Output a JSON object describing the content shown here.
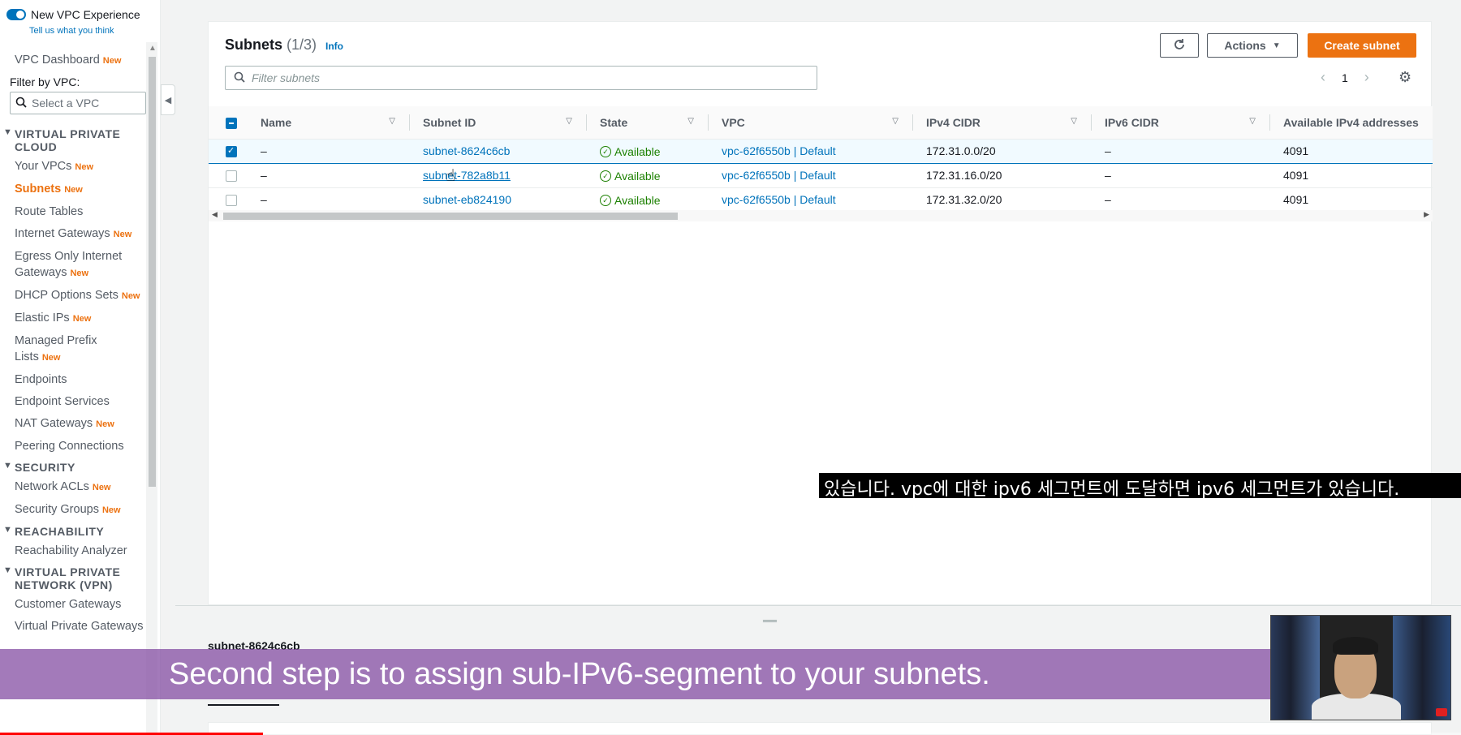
{
  "sidebar": {
    "toggle_label": "New VPC Experience",
    "toggle_sub": "Tell us what you think",
    "dashboard": "VPC Dashboard",
    "new_badge": "New",
    "filter_label": "Filter by VPC:",
    "filter_placeholder": "Select a VPC",
    "section_vpc": "VIRTUAL PRIVATE CLOUD",
    "items_vpc": [
      {
        "label": "Your VPCs",
        "new": true
      },
      {
        "label": "Subnets",
        "new": true
      },
      {
        "label": "Route Tables",
        "new": false
      },
      {
        "label": "Internet Gateways",
        "new": true
      },
      {
        "label": "Egress Only Internet Gateways",
        "new": true
      },
      {
        "label": "DHCP Options Sets",
        "new": true
      },
      {
        "label": "Elastic IPs",
        "new": true
      },
      {
        "label": "Managed Prefix Lists",
        "new": true
      },
      {
        "label": "Endpoints",
        "new": false
      },
      {
        "label": "Endpoint Services",
        "new": false
      },
      {
        "label": "NAT Gateways",
        "new": true
      },
      {
        "label": "Peering Connections",
        "new": false
      }
    ],
    "section_security": "SECURITY",
    "items_security": [
      {
        "label": "Network ACLs",
        "new": true
      },
      {
        "label": "Security Groups",
        "new": true
      }
    ],
    "section_reachability": "REACHABILITY",
    "items_reachability": [
      {
        "label": "Reachability Analyzer"
      }
    ],
    "section_vpn": "VIRTUAL PRIVATE NETWORK (VPN)",
    "items_vpn": [
      {
        "label": "Customer Gateways"
      },
      {
        "label": "Virtual Private Gateways"
      }
    ]
  },
  "main": {
    "title": "Subnets",
    "count": "(1/3)",
    "info": "Info",
    "actions_label": "Actions",
    "create_label": "Create subnet",
    "search_placeholder": "Filter subnets",
    "page_number": "1",
    "columns": [
      "Name",
      "Subnet ID",
      "State",
      "VPC",
      "IPv4 CIDR",
      "IPv6 CIDR",
      "Available IPv4 addresses"
    ],
    "rows": [
      {
        "selected": true,
        "name": "–",
        "subnet_id": "subnet-8624c6cb",
        "state": "Available",
        "vpc": "vpc-62f6550b | Default",
        "ipv4": "172.31.0.0/20",
        "ipv6": "–",
        "available": "4091"
      },
      {
        "selected": false,
        "name": "–",
        "subnet_id": "subnet-782a8b11",
        "state": "Available",
        "vpc": "vpc-62f6550b | Default",
        "ipv4": "172.31.16.0/20",
        "ipv6": "–",
        "available": "4091"
      },
      {
        "selected": false,
        "name": "–",
        "subnet_id": "subnet-eb824190",
        "state": "Available",
        "vpc": "vpc-62f6550b | Default",
        "ipv4": "172.31.32.0/20",
        "ipv6": "–",
        "available": "4091"
      }
    ]
  },
  "detail": {
    "title": "subnet-8624c6cb"
  },
  "captions": {
    "korean": "있습니다. vpc에 대한 ipv6 세그먼트에 도달하면 ipv6 세그먼트가 있습니다.",
    "english": "Second step is to assign sub-IPv6-segment to your subnets."
  },
  "video": {
    "progress": 0.18
  },
  "colors": {
    "accent": "#ec7211",
    "link": "#0073bb",
    "success": "#1d8102",
    "caption_bg": "#8046a0"
  },
  "icons": {
    "refresh": "refresh-icon",
    "search": "search-icon",
    "settings": "gear-icon",
    "status": "check-circle-icon"
  }
}
